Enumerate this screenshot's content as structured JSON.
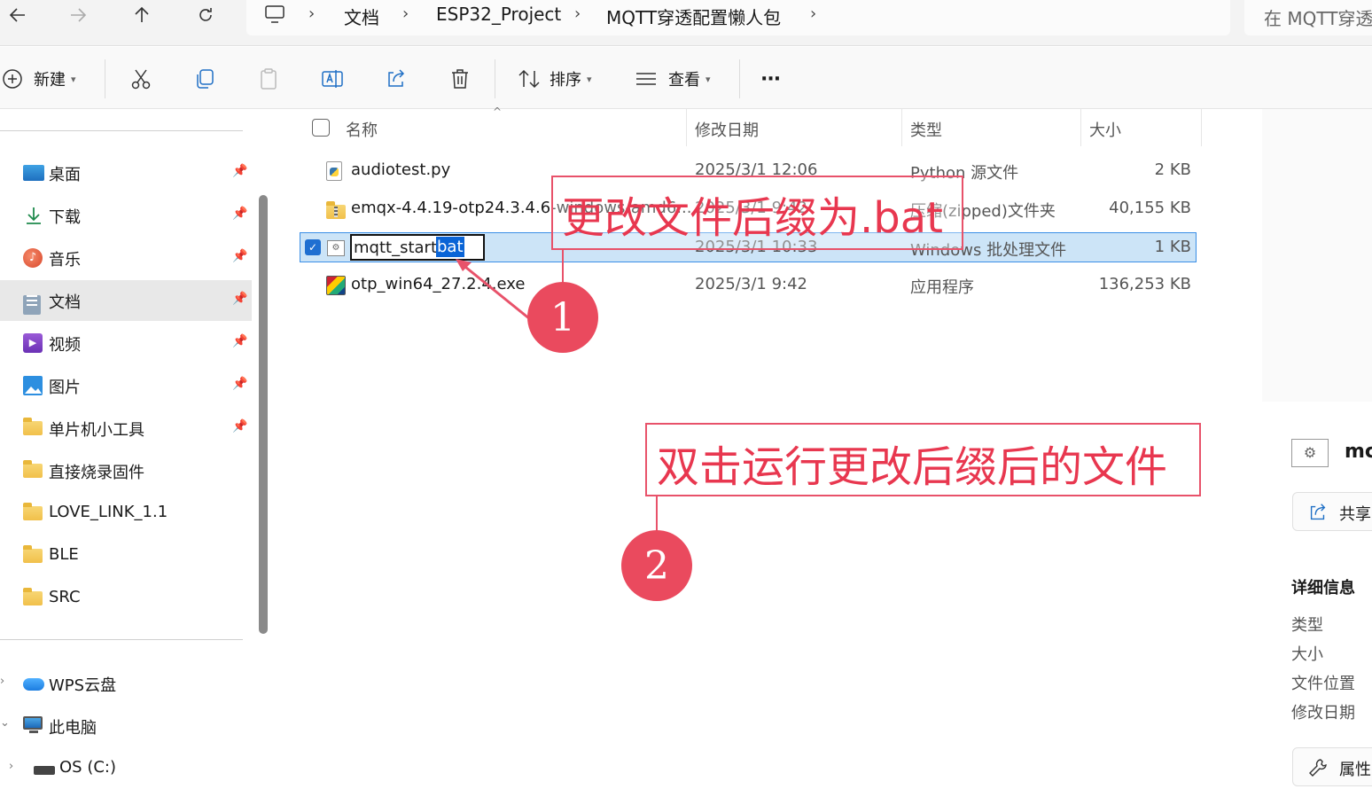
{
  "address_bar": {
    "breadcrumbs": [
      "文档",
      "ESP32_Project",
      "MQTT穿透配置懒人包"
    ],
    "search_placeholder": "在 MQTT穿透"
  },
  "command_bar": {
    "new_label": "新建",
    "sort_label": "排序",
    "view_label": "查看",
    "more_label": "···"
  },
  "nav": {
    "pinned": [
      {
        "label": "桌面",
        "icon": "desktop-icon"
      },
      {
        "label": "下载",
        "icon": "download-icon"
      },
      {
        "label": "音乐",
        "icon": "music-icon"
      },
      {
        "label": "文档",
        "icon": "documents-icon",
        "selected": true
      },
      {
        "label": "视频",
        "icon": "video-icon"
      },
      {
        "label": "图片",
        "icon": "pictures-icon"
      },
      {
        "label": "单片机小工具",
        "icon": "folder-icon"
      },
      {
        "label": "直接烧录固件",
        "icon": "folder-icon"
      },
      {
        "label": "LOVE_LINK_1.1",
        "icon": "folder-icon"
      },
      {
        "label": "BLE",
        "icon": "folder-icon"
      },
      {
        "label": "SRC",
        "icon": "folder-icon"
      }
    ],
    "wps": "WPS云盘",
    "this_pc": "此电脑",
    "os_drive": "OS (C:)"
  },
  "file_list": {
    "headers": {
      "name": "名称",
      "modified": "修改日期",
      "type": "类型",
      "size": "大小"
    },
    "rows": [
      {
        "name": "audiotest.py",
        "modified": "2025/3/1 12:06",
        "type": "Python 源文件",
        "size": "2 KB"
      },
      {
        "name": "emqx-4.4.19-otp24.3.4.6-windows-amd6...",
        "modified": "2025/3/1 9:42",
        "type": "压缩(zipped)文件夹",
        "size": "40,155 KB"
      },
      {
        "name_base": "mqtt_start.",
        "name_ext": "bat",
        "modified": "2025/3/1 10:33",
        "type": "Windows 批处理文件",
        "size": "1 KB",
        "selected": true
      },
      {
        "name": "otp_win64_27.2.4.exe",
        "modified": "2025/3/1 9:42",
        "type": "应用程序",
        "size": "136,253 KB"
      }
    ]
  },
  "details": {
    "file_name_partial": "mc",
    "share_label": "共享",
    "section_title": "详细信息",
    "fields": [
      "类型",
      "大小",
      "文件位置",
      "修改日期"
    ],
    "properties_label": "属性"
  },
  "annotations": {
    "note1": "更改文件后缀为.bat",
    "note2": "双击运行更改后缀后的文件",
    "step1": "1",
    "step2": "2",
    "color": "#e8374f"
  }
}
